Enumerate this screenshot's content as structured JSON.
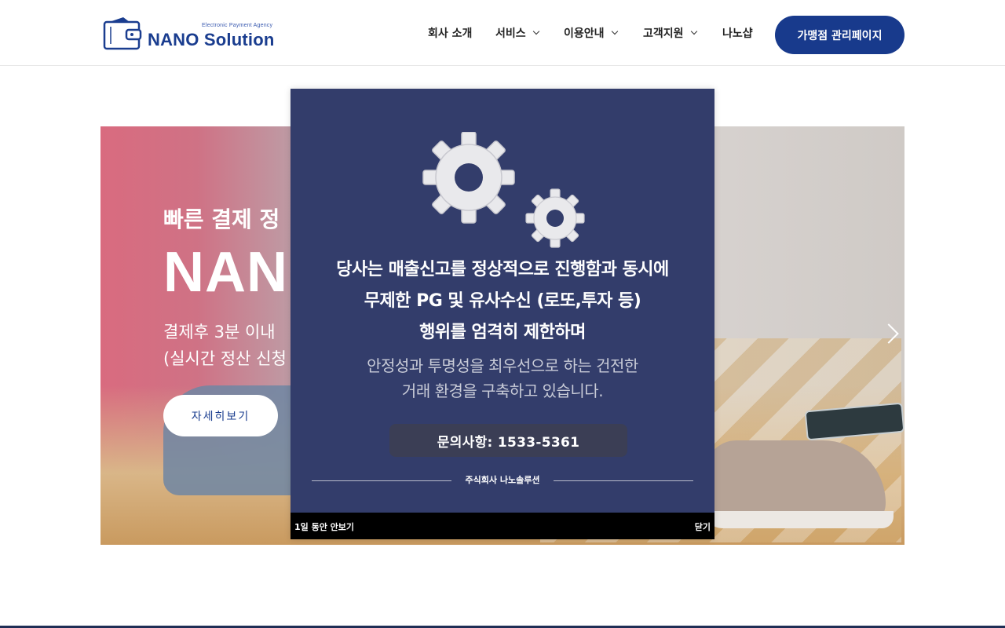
{
  "header": {
    "logo": {
      "tagline": "Electronic Payment Agency",
      "name": "NANO Solution"
    },
    "nav": [
      {
        "label": "회사 소개",
        "has_dropdown": false
      },
      {
        "label": "서비스",
        "has_dropdown": true
      },
      {
        "label": "이용안내",
        "has_dropdown": true
      },
      {
        "label": "고객지원",
        "has_dropdown": true
      },
      {
        "label": "나노샵",
        "has_dropdown": false
      }
    ],
    "cta_label": "가맹점 관리페이지"
  },
  "hero": {
    "small_title": "빠른 결제 정",
    "big_title": "NANO",
    "subtitle_1": "결제후 3분 이내",
    "subtitle_2": "(실시간 정산 신청",
    "button_label": "자세히보기"
  },
  "popup": {
    "line_1": "당사는 매출신고를 정상적으로 진행함과 동시에",
    "line_2": "무제한 PG 및 유사수신 (로또,투자 등)",
    "line_3": "행위를 엄격히 제한하며",
    "line_4": "안정성과 투명성을 최우선으로 하는 건전한",
    "line_5": "거래 환경을 구축하고 있습니다.",
    "contact": "문의사항: 1533-5361",
    "company": "주식회사 나노솔루션",
    "hide_day_label": "1일 동안 안보기",
    "close_label": "닫기"
  },
  "colors": {
    "brand": "#183a8c",
    "popup_bg": "#333d6b",
    "contact_bg": "#3b3e55"
  },
  "icons": [
    "wallet-logo-icon",
    "chevron-down-icon",
    "gear-icon",
    "chevron-right-icon"
  ]
}
